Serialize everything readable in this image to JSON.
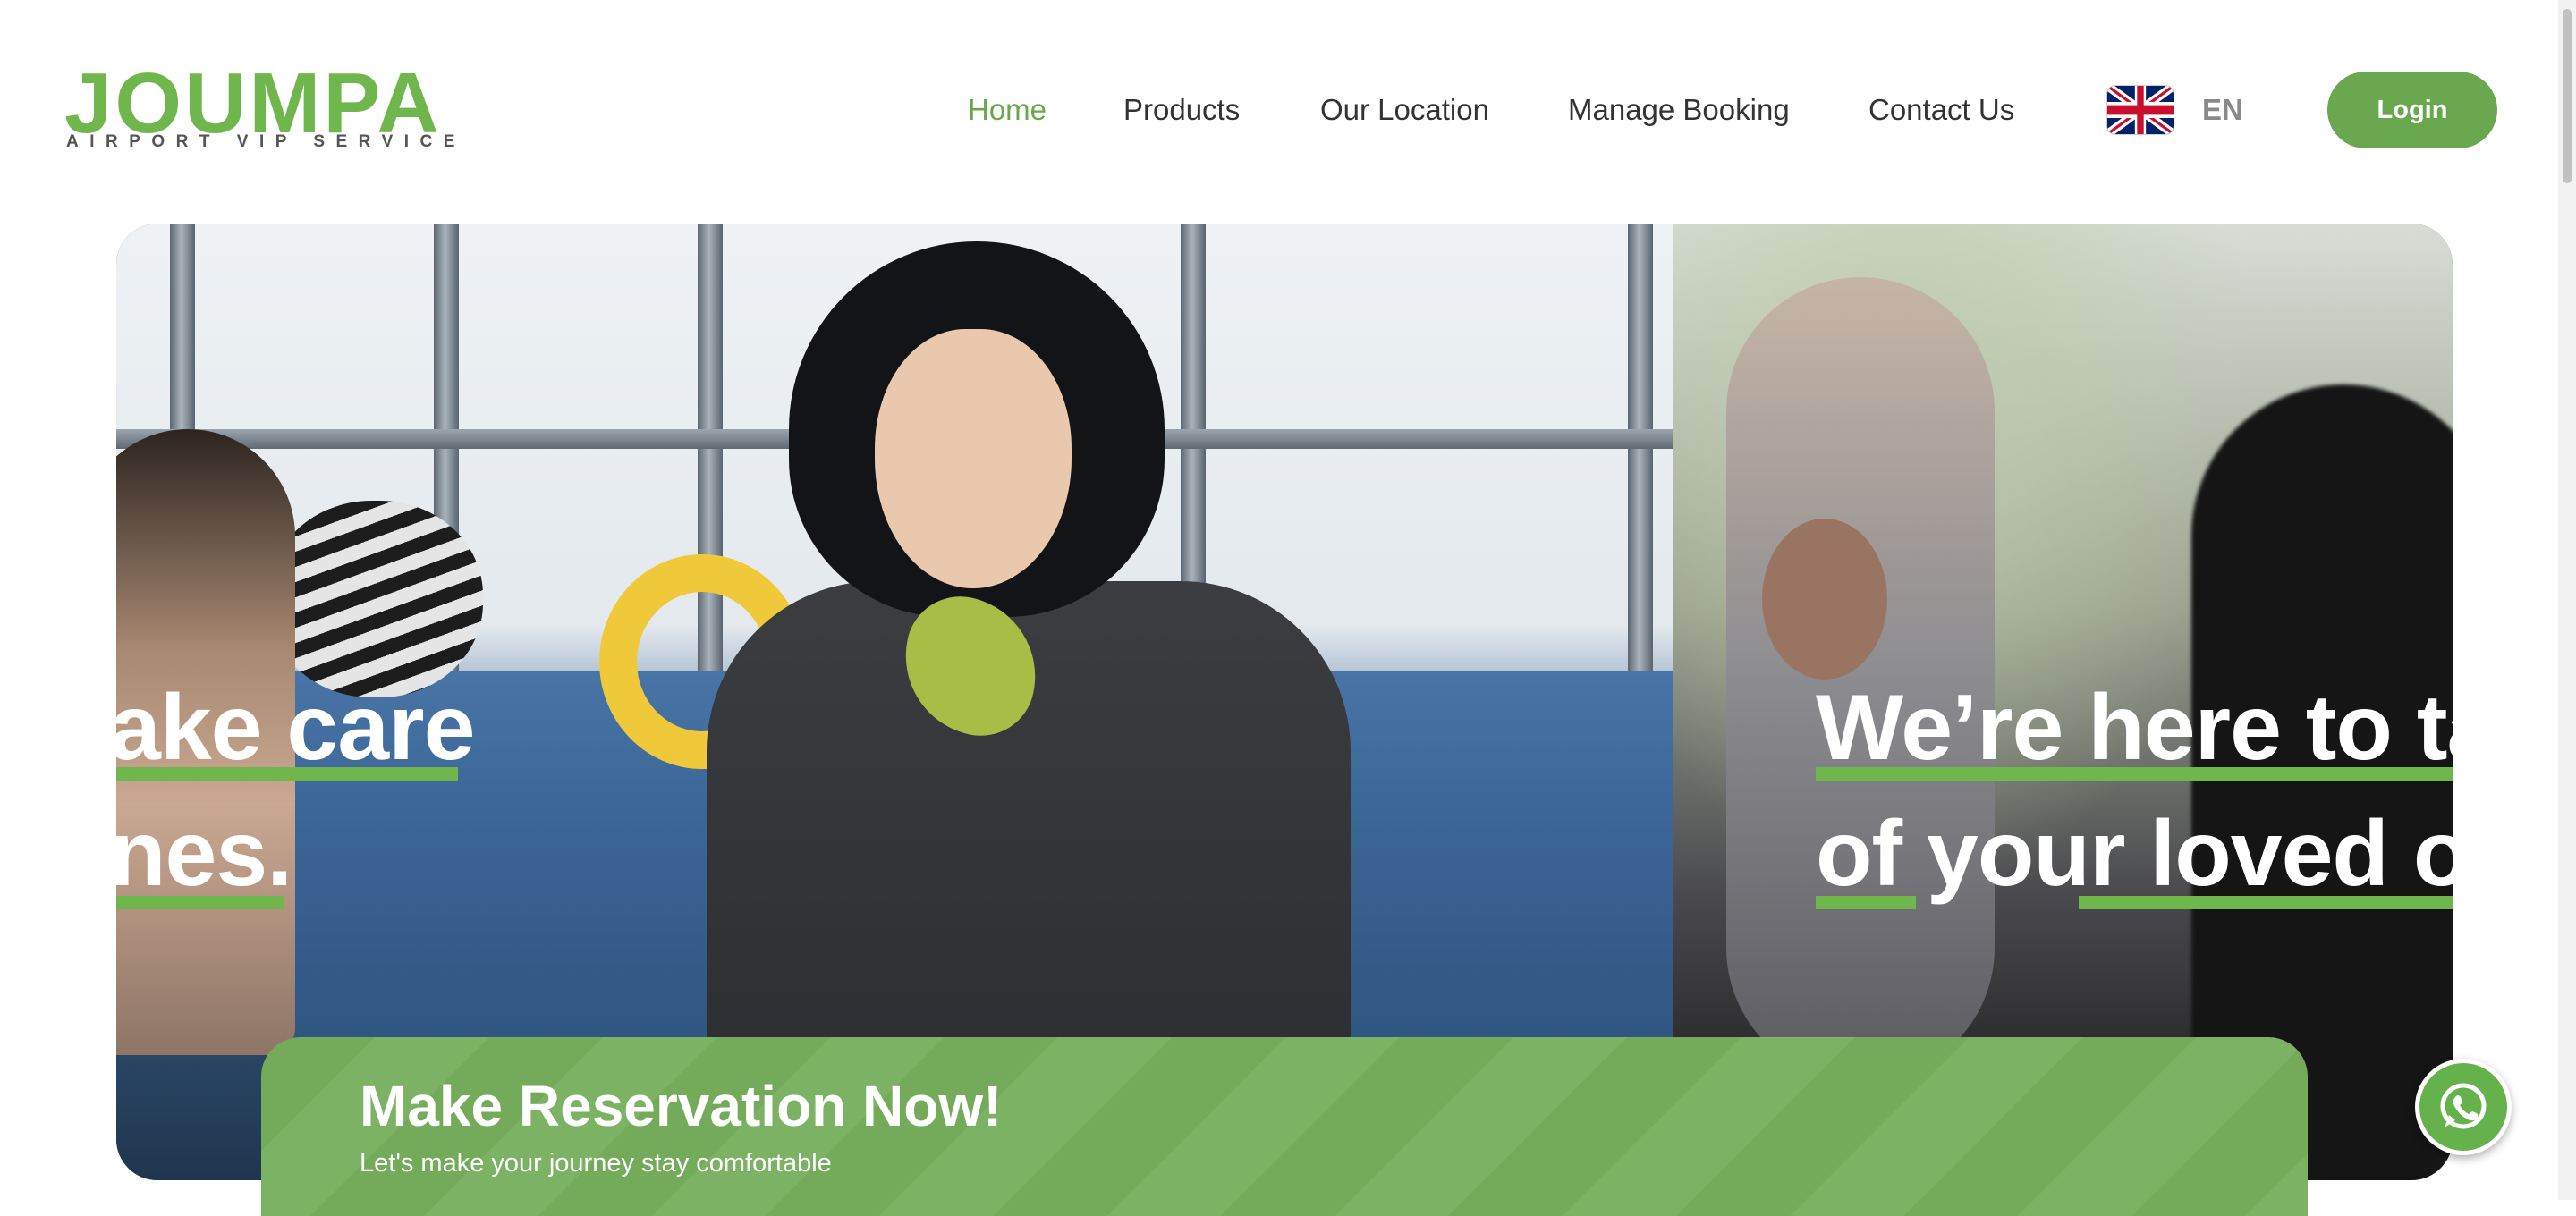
{
  "brand": {
    "name": "JOUMPA",
    "tagline": "AIRPORT VIP SERVICE"
  },
  "nav": {
    "items": [
      {
        "label": "Home",
        "active": true
      },
      {
        "label": "Products",
        "active": false
      },
      {
        "label": "Our Location",
        "active": false
      },
      {
        "label": "Manage Booking",
        "active": false
      },
      {
        "label": "Contact Us",
        "active": false
      }
    ],
    "language": {
      "icon": "uk-flag-icon",
      "code": "EN"
    },
    "login_label": "Login"
  },
  "hero": {
    "slide_left": {
      "line1": "ake care",
      "line2": "nes."
    },
    "slide_right": {
      "line1": "We’re here to ta",
      "line2": "of your loved or"
    }
  },
  "reservation": {
    "title": "Make Reservation Now!",
    "subtitle": "Let's make your journey stay comfortable"
  },
  "floating": {
    "icon": "whatsapp-icon"
  },
  "colors": {
    "accent": "#6aa84f",
    "brand_green": "#6fb74c",
    "banner_green": "#74ab5b",
    "text_dark": "#333333"
  }
}
